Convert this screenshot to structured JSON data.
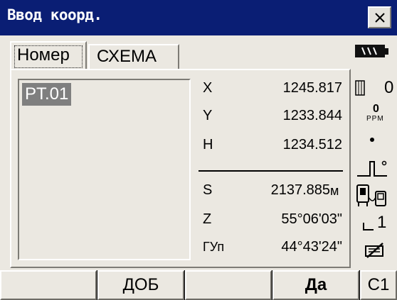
{
  "window": {
    "title": "Ввод коорд."
  },
  "tabs": [
    {
      "label": "Номер",
      "active": true
    },
    {
      "label": "СХЕМА",
      "active": false
    }
  ],
  "point_list": {
    "items": [
      "PT.01"
    ],
    "selected": "PT.01"
  },
  "coordinates": [
    {
      "label": "X",
      "value": "1245.817"
    },
    {
      "label": "Y",
      "value": "1233.844"
    },
    {
      "label": "H",
      "value": "1234.512"
    }
  ],
  "measurements": [
    {
      "label": "S",
      "value": "2137.885",
      "unit": "м"
    },
    {
      "label": "Z",
      "value": "55°06'03\"",
      "unit": ""
    },
    {
      "label": "ГУп",
      "value": "44°43'24\"",
      "unit": ""
    }
  ],
  "status": {
    "prism_constant": "0",
    "ppm_value": "0",
    "ppm_label": "PPM",
    "page": "1",
    "battery_level": "full"
  },
  "softkeys": [
    "",
    "ДОБ",
    "",
    "Да",
    "С1"
  ],
  "colors": {
    "titlebar": "#0a1e74",
    "background": "#ebe8e1",
    "selection": "#7f7f7f"
  }
}
